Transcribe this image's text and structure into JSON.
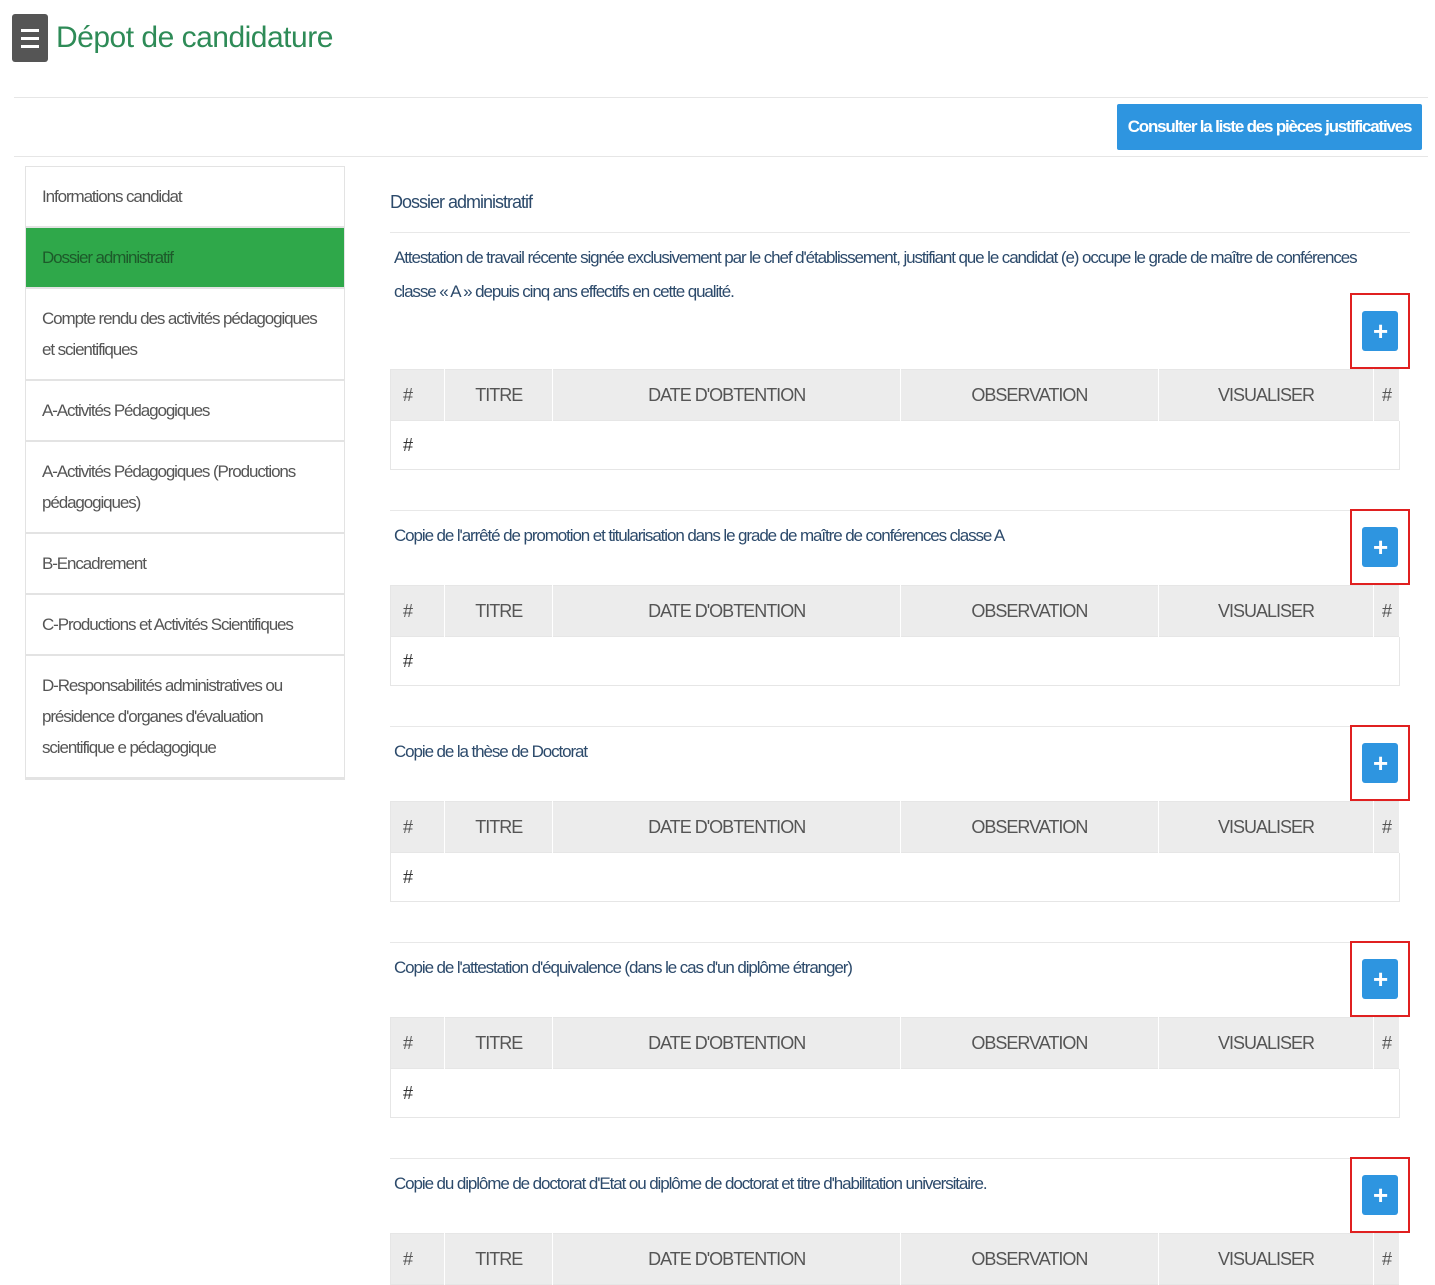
{
  "header": {
    "title": "Dépot de candidature"
  },
  "toolbar": {
    "pieces_button": "Consulter la liste des pièces justificatives"
  },
  "sidebar": {
    "items": [
      {
        "label": "Informations candidat",
        "active": false
      },
      {
        "label": "Dossier administratif",
        "active": true
      },
      {
        "label": "Compte rendu des activités pédagogiques et scientifiques",
        "active": false
      },
      {
        "label": "A-Activités Pédagogiques",
        "active": false
      },
      {
        "label": "A-Activités Pédagogiques (Productions pédagogiques)",
        "active": false
      },
      {
        "label": "B-Encadrement",
        "active": false
      },
      {
        "label": "C-Productions et Activités Scientifiques",
        "active": false
      },
      {
        "label": "D-Responsabilités administratives ou présidence d'organes d'évaluation scientifique e pédagogique",
        "active": false
      }
    ]
  },
  "main": {
    "title": "Dossier administratif",
    "columns": [
      "#",
      "TITRE",
      "DATE D'OBTENTION",
      "OBSERVATION",
      "VISUALISER",
      "#"
    ],
    "empty_row": "#",
    "add_icon": "plus-icon",
    "sections": [
      {
        "label": "Attestation de travail récente signée exclusivement par le chef d'établissement, justifiant que le candidat (e) occupe le grade de maître de conférences classe « A » depuis cinq ans effectifs en cette qualité."
      },
      {
        "label": "Copie de l'arrêté de promotion et titularisation dans le grade de maître de conférences classe A"
      },
      {
        "label": "Copie de la thèse de Doctorat"
      },
      {
        "label": "Copie de l'attestation d'équivalence (dans le cas d'un diplôme étranger)"
      },
      {
        "label": "Copie du diplôme de doctorat d'Etat ou diplôme de doctorat et titre d'habilitation universitaire."
      }
    ]
  },
  "colors": {
    "accent_green": "#2fa84a",
    "title_green": "#2e8b57",
    "button_blue": "#2e95e0",
    "highlight_red": "#e02020"
  }
}
